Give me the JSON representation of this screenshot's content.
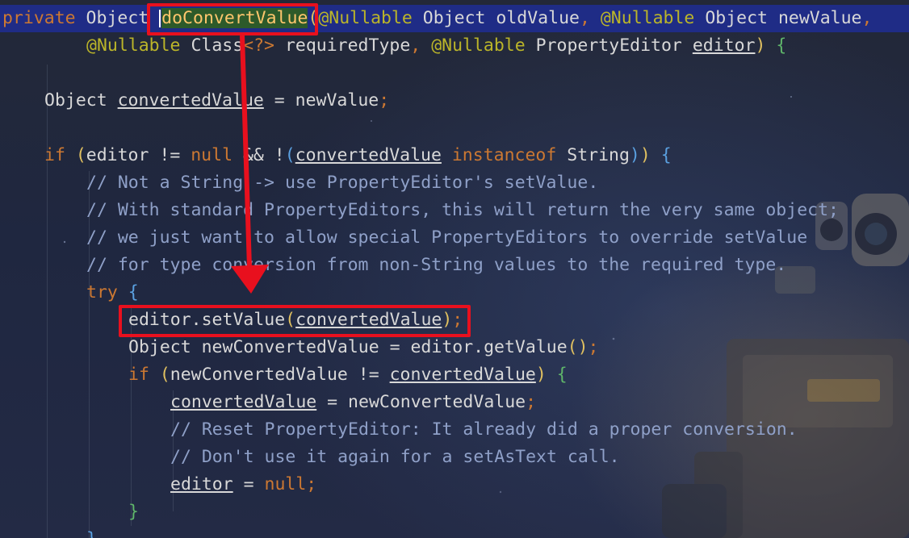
{
  "code": {
    "line1": {
      "private": "private",
      "object1": " Object ",
      "method": "doConvertValue",
      "paren": "(",
      "nullable1": "@Nullable",
      "object2": " Object ",
      "old_value": "oldValue",
      "comma1": ",",
      "nullable2": " @Nullable",
      "object3": " Object ",
      "new_value": "newValue",
      "comma2": ","
    },
    "line2": {
      "nullable3": "@Nullable",
      "class_type": " Class",
      "generic": "<?> ",
      "required_type": "requiredType",
      "comma": ",",
      "nullable4": " @Nullable",
      "pe_type": " PropertyEditor ",
      "editor": "editor",
      "close": ")",
      "brace": " {"
    },
    "line3": {
      "type": "Object ",
      "var": "convertedValue",
      "assign": " = newValue",
      "semi": ";"
    },
    "line4": {
      "if": "if",
      "open": " (",
      "cond1": "editor != ",
      "null": "null",
      "and": " && !",
      "open2": "(",
      "var": "convertedValue",
      "instanceof": " instanceof",
      "string": " String",
      "close2": ")",
      "close1": ")",
      "brace": " {"
    },
    "comments": [
      "// Not a String -> use PropertyEditor's setValue.",
      "// With standard PropertyEditors, this will return the very same object;",
      "// we just want to allow special PropertyEditors to override setValue",
      "// for type conversion from non-String values to the required type."
    ],
    "try": {
      "kw": "try",
      "brace": " {"
    },
    "set_value": {
      "call": "editor.setValue",
      "open": "(",
      "arg": "convertedValue",
      "close": ")",
      "semi": ";"
    },
    "get_value": {
      "decl": "Object newConvertedValue = editor.getValue",
      "parens": "()",
      "semi": ";"
    },
    "if2": {
      "if": "if",
      "open": " (",
      "cond": "newConvertedValue != ",
      "var": "convertedValue",
      "close": ")",
      "brace": " {"
    },
    "assign2": {
      "var": "convertedValue",
      "rest": " = newConvertedValue",
      "semi": ";"
    },
    "comments2": [
      "// Reset PropertyEditor: It already did a proper conversion.",
      "// Don't use it again for a setAsText call."
    ],
    "editor_null": {
      "var": "editor",
      "rest": " = ",
      "null": "null",
      "semi": ";"
    },
    "close_inner": "}",
    "close_outer": "}"
  },
  "colors": {
    "keyword": "#cc7832",
    "annotation": "#bbb529",
    "method": "#ffc66d",
    "comment": "#8fa0c8",
    "text": "#d8d8d8",
    "highlight_line": "#1f2c86",
    "annotation_box": "#e8101e"
  }
}
